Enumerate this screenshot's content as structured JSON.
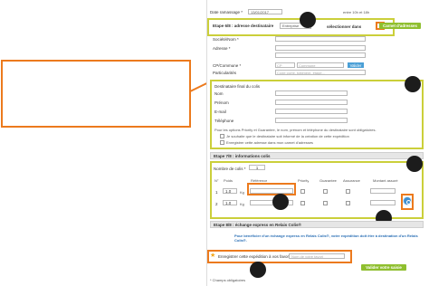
{
  "form": {
    "top_left_label": "Date ramassage *",
    "top_date_value": "13/01/2017",
    "top_right_note": "entre 10h et 18h",
    "step6": {
      "title": "Etape 6/8 : adresse destinataire",
      "type_value": "Entreprise",
      "select_label": "sélectionner dans",
      "select_button": "Carnet d'adresses",
      "societe_label": "Société/Nom *",
      "adresse_label": "Adresse *",
      "cp_label": "CP/Commune *",
      "cp_placeholder": "CP",
      "commune_placeholder": "Commune",
      "geo_button": "Valider",
      "particularites_label": "Particularités",
      "particularites_placeholder": "Code porte, bâtiment, étage...",
      "destinataire_title": "Destinataire final du colis",
      "nom_label": "Nom",
      "prenom_label": "Prénom",
      "email_label": "E-mail",
      "telephone_label": "Téléphone",
      "info_note": "Pour les options Priority et Guarantee, le nom, prénom et téléphone du destinataire sont obligatoires.",
      "check1": "Je souhaite que le destinataire soit informé de la création de cette expédition",
      "check2": "Enregistrer cette adresse dans mon carnet d'adresses"
    },
    "step7": {
      "title": "Etape 7/8 : informations colis",
      "nb_colis_label": "Nombre de colis *",
      "nb_colis_value": "1",
      "headers": [
        "N°",
        "Poids",
        "Référence",
        "Priority",
        "Guarantee",
        "Assurance",
        "Montant assuré"
      ],
      "rows": [
        {
          "n": "1",
          "poids": "1.0",
          "unit": "Kg"
        },
        {
          "n": "2",
          "poids": "1.0",
          "unit": "Kg"
        }
      ]
    },
    "step8": {
      "title": "Etape 8/8 : échange express en Relais Colis®",
      "note": "Pour bénéficier d'un échange express en Relais Colis®, votre expédition doit être à destination d'un Relais Colis®.",
      "favorite_label": "Enregistrer cette expédition à vos favoris",
      "favorite_placeholder": "Nom de votre favori",
      "submit_button": "Valider votre saisie"
    },
    "required_note": "* Champs obligatoires"
  },
  "colors": {
    "highlight_yellow": "#cbcf3a",
    "highlight_orange": "#ec7a1d",
    "button_green": "#8fbf2f",
    "marker": "#1c1c1c"
  }
}
